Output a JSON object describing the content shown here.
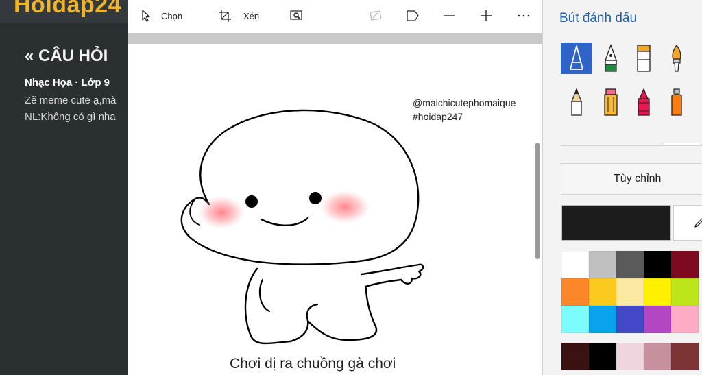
{
  "background_site": {
    "logo": "Hoidap24",
    "title": "« CÂU HỎI",
    "subject": "Nhạc Họa · Lớp 9",
    "lines": [
      "Zẽ meme cute ạ,mà",
      "NL:Không có gì nha"
    ]
  },
  "toolbar": {
    "select_label": "Chọn",
    "crop_label": "Xén"
  },
  "canvas": {
    "watermark_line1": "@maichicutephomaique",
    "watermark_line2": "#hoidap247",
    "caption": "Chơi dị ra chuồng gà chơi"
  },
  "pane": {
    "title": "Bút đánh dấu",
    "custom_label": "Tùy chỉnh",
    "current_color": "#1c1c1c",
    "tools": [
      {
        "name": "ballpoint-pen-icon",
        "selected": true
      },
      {
        "name": "calligraphy-pen-icon",
        "selected": false
      },
      {
        "name": "marker-icon",
        "selected": false
      },
      {
        "name": "paintbrush-icon",
        "selected": false
      },
      {
        "name": "pencil-icon",
        "selected": false
      },
      {
        "name": "highlighter-icon",
        "selected": false
      },
      {
        "name": "crayon-icon",
        "selected": false
      },
      {
        "name": "spray-can-icon",
        "selected": false
      }
    ],
    "swatch_rows": [
      [
        "#ffffff",
        "#c0c0c0",
        "#5a5a5a",
        "#000000",
        "#7d0a1e"
      ],
      [
        "#fb8728",
        "#fcc91e",
        "#fce9a1",
        "#fef000",
        "#bce51a"
      ],
      [
        "#7cfcfe",
        "#08a3ec",
        "#4248c8",
        "#b246c3",
        "#fdacc6"
      ],
      [
        "#3b1212",
        "#000000",
        "#efd5dd",
        "#c6919c",
        "#7c3434"
      ]
    ]
  }
}
